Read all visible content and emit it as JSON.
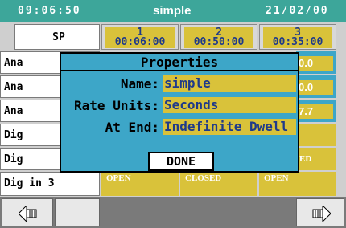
{
  "header": {
    "time": "09:06:50",
    "program": "simple",
    "date": "21/02/00"
  },
  "grid": {
    "sp_label": "SP",
    "steps": [
      {
        "number": "1",
        "duration": "00:06:00"
      },
      {
        "number": "2",
        "duration": "00:50:00"
      },
      {
        "number": "3",
        "duration": "00:35:00"
      }
    ],
    "rows": [
      {
        "label": "Ana",
        "right_value": "0.0"
      },
      {
        "label": "Ana",
        "right_value": "0.0"
      },
      {
        "label": "Ana",
        "right_value": "7.7"
      },
      {
        "label": "Dig",
        "right_value": ""
      },
      {
        "label": "Dig",
        "right_value": "ED"
      },
      {
        "label": "Dig in 3",
        "values": [
          "OPEN",
          "CLOSED",
          "OPEN"
        ]
      }
    ]
  },
  "dialog": {
    "title": "Properties",
    "fields": [
      {
        "label": "Name:",
        "value": "simple"
      },
      {
        "label": "Rate Units:",
        "value": "Seconds"
      },
      {
        "label": "At End:",
        "value": "Indefinite Dwell"
      }
    ],
    "done_label": "DONE"
  },
  "footer": {
    "left_icon": "scroll-left-icon",
    "right_icon": "scroll-right-icon"
  },
  "colors": {
    "teal": "#3da69a",
    "yellow": "#d9c23a",
    "blue": "#3da6c8",
    "dark_blue": "#1f3a8a"
  }
}
